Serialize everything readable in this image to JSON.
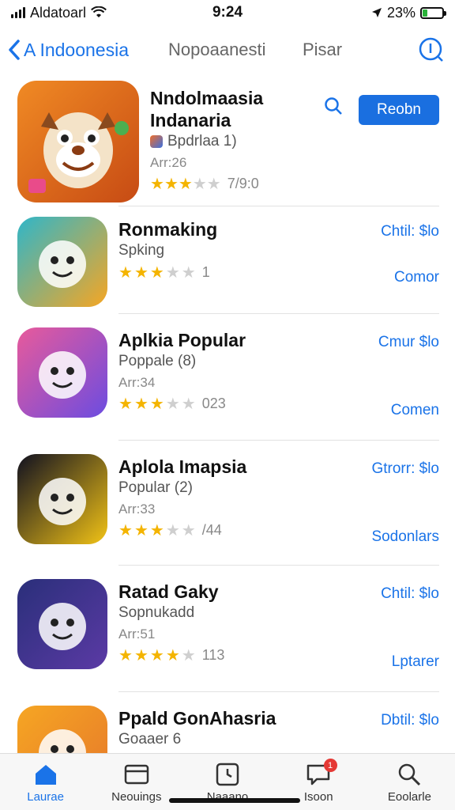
{
  "status_bar": {
    "carrier": "Aldatoarl",
    "time": "9:24",
    "battery": "23%",
    "battery_level": 0.23
  },
  "nav": {
    "back_label": "A Indoonesia",
    "center_label": "Nopoaanesti",
    "right_label": "Pisar"
  },
  "featured": {
    "title_line1": "Nndolmaasia",
    "title_line2": "Indanaria",
    "sub": "Bpdrlaa 1)",
    "meta": "Arr:26",
    "rating": 3.5,
    "rating_text": "7/9:0",
    "get_label": "Reobn"
  },
  "apps": [
    {
      "title": "Ronmaking",
      "sub": "Spking",
      "meta": "",
      "rating": 3.5,
      "rating_text": "1",
      "price": "Chtil: $lo",
      "action": "Comor",
      "colors": [
        "#2fb6c9",
        "#f6a623"
      ]
    },
    {
      "title": "Aplkia Popular",
      "sub": "Poppale (8)",
      "meta": "Arr:34",
      "rating": 3.5,
      "rating_text": "023",
      "price": "Cmur $lo",
      "action": "Comen",
      "colors": [
        "#e85a9b",
        "#6c4ce0"
      ]
    },
    {
      "title": "Aplola Imapsia",
      "sub": "Popular (2)",
      "meta": "Arr:33",
      "rating": 3.5,
      "rating_text": "/44",
      "price": "Gtrorr: $lo",
      "action": "Sodonlars",
      "colors": [
        "#101020",
        "#f2c316"
      ]
    },
    {
      "title": "Ratad Gaky",
      "sub": "Sopnukadd",
      "meta": "Arr:51",
      "rating": 4,
      "rating_text": "113",
      "price": "Chtil: $lo",
      "action": "Lptarer",
      "colors": [
        "#2a2f7a",
        "#5b3aa5"
      ]
    },
    {
      "title": "Ppald GonAhasria",
      "sub": "Goaaer 6",
      "meta": "",
      "rating": 0,
      "rating_text": "",
      "price": "Dbtil: $lo",
      "action": "",
      "colors": [
        "#f6a623",
        "#e6782a"
      ]
    }
  ],
  "tabs": [
    {
      "label": "Laurae",
      "icon": "home-icon"
    },
    {
      "label": "Neouings",
      "icon": "card-icon"
    },
    {
      "label": "Naaano",
      "icon": "clock-icon"
    },
    {
      "label": "Isoon",
      "icon": "chat-icon",
      "badge": "1"
    },
    {
      "label": "Eoolarle",
      "icon": "search-icon"
    }
  ],
  "accent": "#1a73e8"
}
